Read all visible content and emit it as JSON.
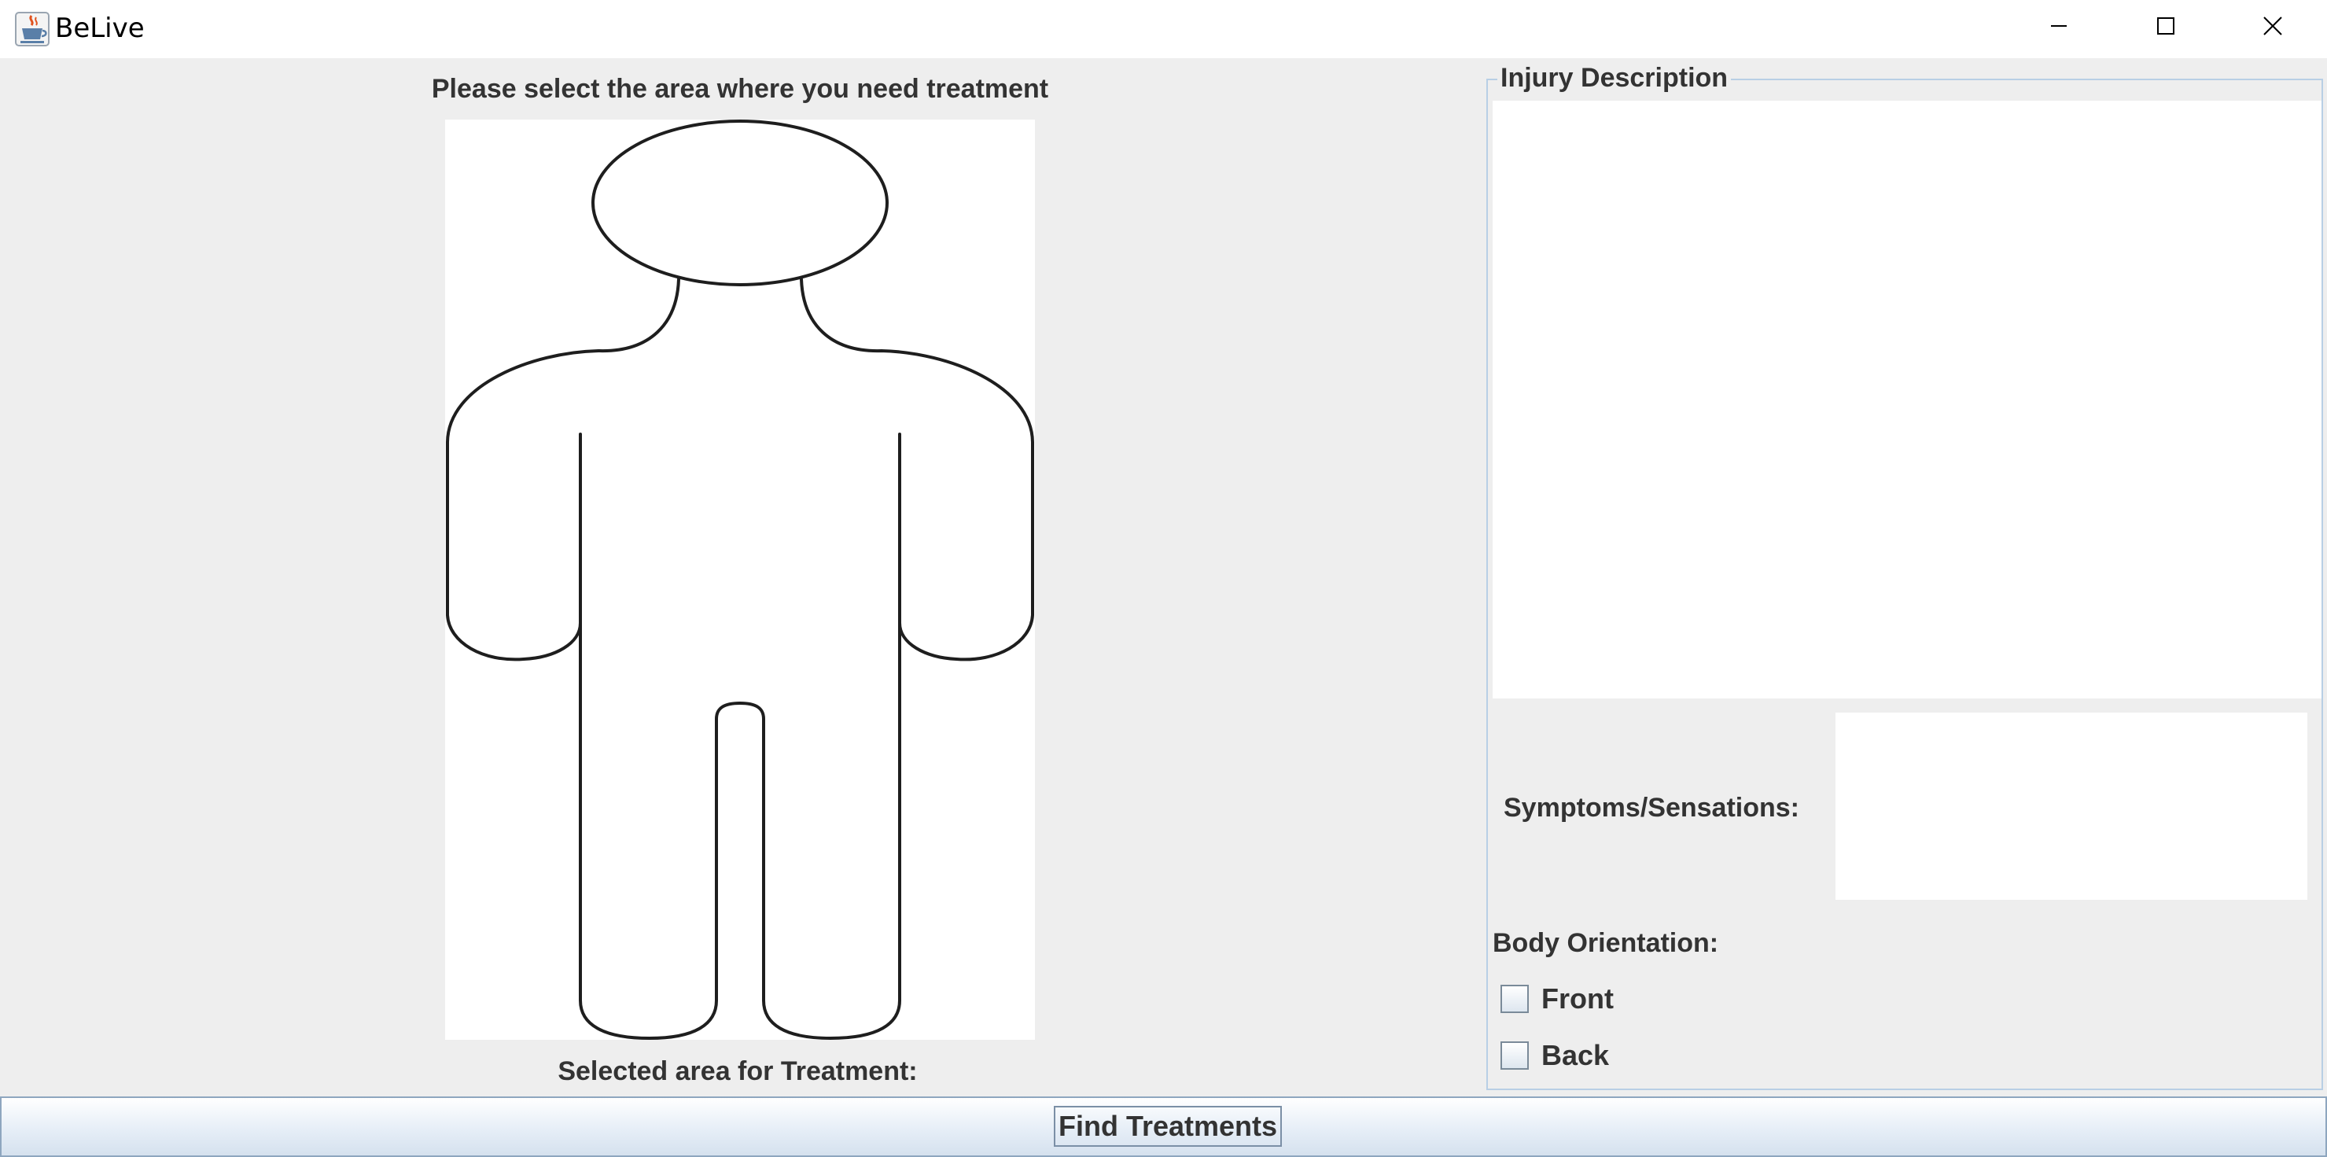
{
  "window": {
    "title": "BeLive",
    "icon": "java-cup-icon"
  },
  "title_bar_controls": [
    "minimize-icon",
    "maximize-icon",
    "close-icon"
  ],
  "left_panel": {
    "prompt": "Please select the area where you need treatment",
    "figure_icon": "human-body-outline",
    "selected_area_label": "Selected area for Treatment:"
  },
  "right_panel": {
    "group_title": "Injury Description",
    "injury_text": "",
    "symptoms_label": "Symptoms/Sensations:",
    "symptoms_value": "",
    "orientation_label": "Body Orientation:",
    "options": [
      {
        "label": "Front",
        "checked": false
      },
      {
        "label": "Back",
        "checked": false
      }
    ]
  },
  "bottom": {
    "button_label": "Find Treatments"
  },
  "colors": {
    "background": "#eeeeee",
    "group_border": "#b8cfe5",
    "label_text": "#333333"
  }
}
